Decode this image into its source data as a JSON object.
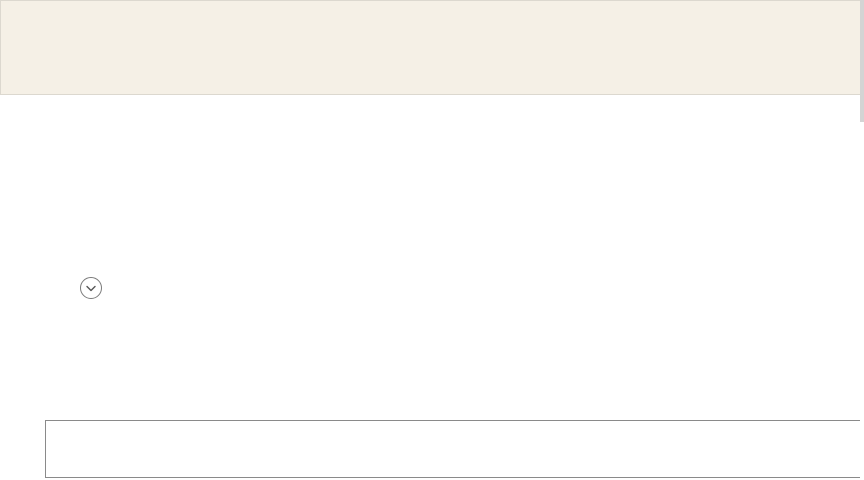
{
  "window": {
    "title": ""
  },
  "banner": {
    "text": ""
  },
  "expand_toggle": {
    "icon": "chevron-down-icon",
    "label": ""
  },
  "bottom_box": {
    "value": ""
  },
  "colors": {
    "banner_background": "#f5f0e6",
    "banner_border": "#dcd8cf",
    "toggle_outline": "#7a7a7a",
    "box_border": "#8a8a8a"
  }
}
